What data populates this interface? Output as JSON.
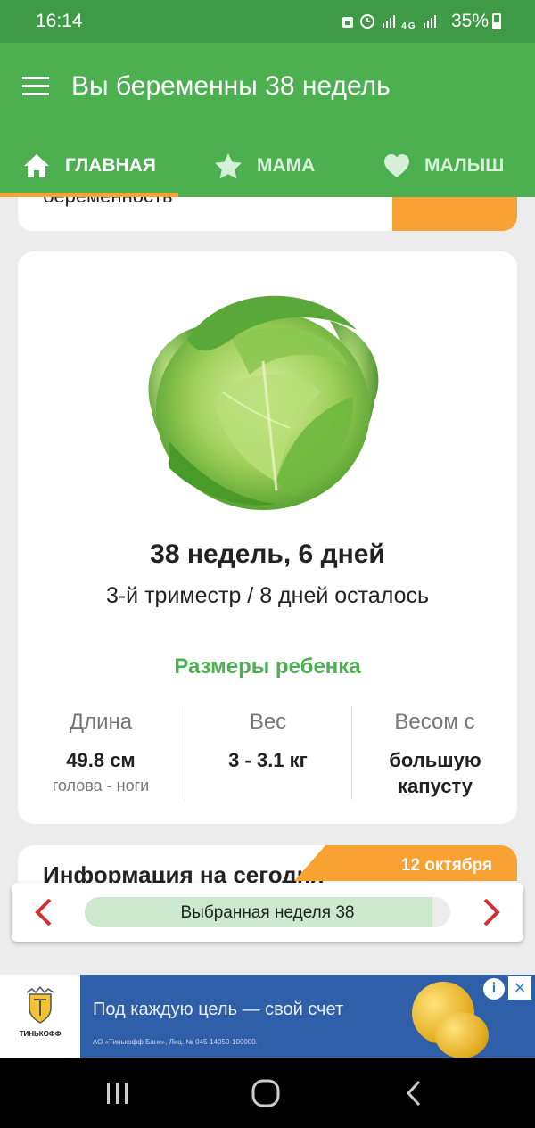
{
  "status_bar": {
    "time": "16:14",
    "icons": [
      "alarm-icon",
      "clock-icon",
      "signal-icon",
      "4g-icon",
      "signal-icon"
    ],
    "network": "4G",
    "battery": "35%"
  },
  "app_bar": {
    "title": "Вы беременны 38 недель",
    "color": "#4caf50"
  },
  "tabs": [
    {
      "label": "ГЛАВНАЯ",
      "icon": "home-icon",
      "active": true
    },
    {
      "label": "МАМА",
      "icon": "star-icon",
      "active": false
    },
    {
      "label": "МАЛЫШ",
      "icon": "heart-icon",
      "active": false
    }
  ],
  "top_card": {
    "text": "беременность"
  },
  "main_card": {
    "image": "cabbage",
    "week_title": "38 недель, 6 дней",
    "trimester": "3-й триместр / 8 дней осталось",
    "sizes_title": "Размеры ребенка",
    "stats": [
      {
        "label": "Длина",
        "value": "49.8 см",
        "sub": "голова - ноги"
      },
      {
        "label": "Вес",
        "value": "3 - 3.1 кг",
        "sub": ""
      },
      {
        "label": "Весом с",
        "value": "большую капусту",
        "sub": ""
      }
    ]
  },
  "info_card": {
    "title": "Информация на сегодня",
    "date": "12 октября"
  },
  "week_selector": {
    "label": "Выбранная неделя 38",
    "progress": 0.95
  },
  "ad": {
    "brand": "ТИНЬКОФФ",
    "title": "Под каждую цель — свой счет",
    "sub": "АО «Тинькофф Банк», Лиц. № 045-14050-100000."
  },
  "colors": {
    "accent": "#4caf50",
    "orange": "#f7a232",
    "arrow": "#d32f2f"
  }
}
